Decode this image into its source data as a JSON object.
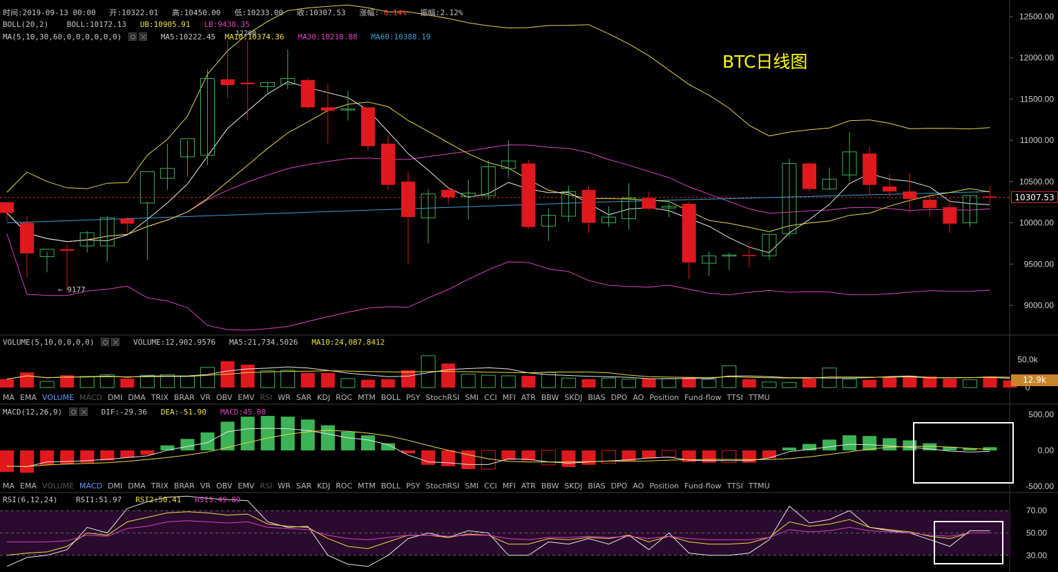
{
  "header": {
    "time_label": "时间:2019-09-13 00:00",
    "open_label": "开:10322.01",
    "high_label": "高:10450.00",
    "low_label": "低:10233.00",
    "close_label": "收:10307.53",
    "change_label": "涨幅:",
    "change_value": "-0.14%",
    "amplitude_label": "振幅:2.12%"
  },
  "boll": {
    "name": "BOLL(20,2)",
    "boll": "BOLL:10172.13",
    "ub": "UB:10905.91",
    "lb": "LB:9438.35"
  },
  "ma": {
    "name": "MA(5,10,30,60,0,0,0,0,0,0)",
    "ma5": "MA5:10222.45",
    "ma10": "MA10:10374.36",
    "ma30": "MA30:10218.88",
    "ma60": "MA60:10388.19"
  },
  "title": "BTC日线图",
  "price_tag": "10307.53",
  "volume_tag": "12.9k",
  "high_marker": "12200",
  "low_marker": "← 9177",
  "volume": {
    "name": "VOLUME(5,10,0,0,0,0)",
    "volume": "VOLUME:12,902.9576",
    "ma5": "MA5:21,734.5026",
    "ma10": "MA10:24,087.8412"
  },
  "macd": {
    "name": "MACD(12,26,9)",
    "dif": "DIF:-29.36",
    "dea": "DEA:-51.90",
    "macd": "MACD:45.08"
  },
  "rsi": {
    "name": "RSI(6,12,24)",
    "rsi1": "RSI1:51.97",
    "rsi2": "RSI2:50.41",
    "rsi3": "RSI3:49.89"
  },
  "indicator_tabs": [
    "MA",
    "EMA",
    "VOLUME",
    "MACD",
    "DMI",
    "DMA",
    "TRIX",
    "BRAR",
    "VR",
    "OBV",
    "EMV",
    "RSI",
    "WR",
    "SAR",
    "KDJ",
    "ROC",
    "MTM",
    "BOLL",
    "PSY",
    "StochRSI",
    "SMI",
    "CCI",
    "MFI",
    "ATR",
    "BBW",
    "SKDJ",
    "BIAS",
    "DPO",
    "AO",
    "Position",
    "Fund-flow",
    "TTSI",
    "TTMU"
  ],
  "colors": {
    "up": "#e0191e",
    "down": "#3cb357",
    "boll_up": "#e8d44d",
    "boll_mid": "#d8d8d8",
    "boll_low": "#e040c0",
    "ma5": "#e8e8e8",
    "ma10": "#f0dd40",
    "ma30": "#e040c0",
    "ma60": "#3aa0e0"
  },
  "chart_data": [
    {
      "type": "candlestick",
      "title": "BTC日线图",
      "ylim": [
        8800,
        12600
      ],
      "yticks": [
        9000,
        9500,
        10000,
        10500,
        11000,
        11500,
        12000,
        12500
      ],
      "ytick_labels": [
        "9000.00",
        "9500.00",
        "10000.00",
        "10500.00",
        "11000.00",
        "11500.00",
        "12000.00",
        "12500.00"
      ],
      "last_price": 10307.53,
      "candles": [
        [
          10250,
          10250,
          10020,
          10120
        ],
        [
          10000,
          10080,
          9340,
          9630
        ],
        [
          9590,
          9650,
          9400,
          9680
        ],
        [
          9680,
          9740,
          9177,
          9660
        ],
        [
          9720,
          9900,
          9640,
          9880
        ],
        [
          9720,
          10080,
          9530,
          10060
        ],
        [
          10050,
          10070,
          9880,
          9990
        ],
        [
          10240,
          10260,
          9550,
          10620
        ],
        [
          10540,
          10960,
          10400,
          10660
        ],
        [
          10800,
          11000,
          10560,
          11020
        ],
        [
          10820,
          11860,
          10700,
          11750
        ],
        [
          11740,
          12200,
          11510,
          11670
        ],
        [
          11700,
          12200,
          11240,
          11680
        ],
        [
          11650,
          11700,
          11560,
          11700
        ],
        [
          11680,
          12100,
          11620,
          11750
        ],
        [
          11730,
          11760,
          11380,
          11400
        ],
        [
          11400,
          11680,
          10960,
          11360
        ],
        [
          11380,
          11600,
          11240,
          11380
        ],
        [
          11400,
          11400,
          10880,
          10930
        ],
        [
          10960,
          11070,
          10400,
          10460
        ],
        [
          10500,
          10620,
          9500,
          10070
        ],
        [
          10060,
          10410,
          9750,
          10350
        ],
        [
          10400,
          10440,
          10220,
          10310
        ],
        [
          10320,
          10520,
          10040,
          10360
        ],
        [
          10330,
          10760,
          10280,
          10680
        ],
        [
          10660,
          11000,
          10550,
          10750
        ],
        [
          10720,
          10760,
          9930,
          9950
        ],
        [
          9960,
          10180,
          9780,
          10090
        ],
        [
          10080,
          10450,
          10010,
          10380
        ],
        [
          10400,
          10450,
          9880,
          10000
        ],
        [
          10000,
          10200,
          9950,
          10070
        ],
        [
          10050,
          10480,
          9920,
          10300
        ],
        [
          10300,
          10380,
          10150,
          10170
        ],
        [
          10180,
          10240,
          10070,
          10200
        ],
        [
          10230,
          10260,
          9320,
          9520
        ],
        [
          9510,
          9650,
          9360,
          9600
        ],
        [
          9600,
          9640,
          9430,
          9610
        ],
        [
          9610,
          9760,
          9460,
          9600
        ],
        [
          9600,
          9860,
          9550,
          9860
        ],
        [
          9870,
          10780,
          9830,
          10720
        ],
        [
          10720,
          10730,
          10380,
          10410
        ],
        [
          10410,
          10670,
          10400,
          10530
        ],
        [
          10580,
          11100,
          10510,
          10860
        ],
        [
          10840,
          10920,
          10330,
          10460
        ],
        [
          10440,
          10590,
          10320,
          10380
        ],
        [
          10380,
          10600,
          10120,
          10290
        ],
        [
          10280,
          10350,
          10070,
          10180
        ],
        [
          10190,
          10280,
          9880,
          9990
        ],
        [
          10000,
          10330,
          9950,
          10330
        ],
        [
          10320,
          10450,
          10233,
          10307.53
        ]
      ]
    },
    {
      "type": "bar",
      "title": "VOLUME(5,10,0,0,0,0)",
      "ytick_labels": [
        "50.0k",
        "0"
      ],
      "ylim": [
        0,
        68000
      ],
      "values": [
        15000,
        27000,
        11000,
        22000,
        20000,
        23000,
        16000,
        22000,
        23000,
        20000,
        36000,
        47000,
        41000,
        30000,
        31000,
        26000,
        26000,
        16000,
        14000,
        15000,
        31000,
        57000,
        43000,
        24000,
        22000,
        21000,
        21000,
        27000,
        17000,
        15000,
        17000,
        15000,
        16000,
        16000,
        18000,
        15000,
        39000,
        15000,
        10000,
        9000,
        16000,
        35000,
        15000,
        14000,
        18000,
        21000,
        20000,
        16000,
        14000,
        20000,
        12900
      ]
    },
    {
      "type": "bar",
      "title": "MACD(12,26,9)",
      "ytick_labels": [
        "500.00",
        "0.00",
        "-500.00"
      ],
      "ylim": [
        -500,
        500
      ],
      "values": [
        -300,
        -310,
        -200,
        -190,
        -170,
        -140,
        -100,
        -60,
        70,
        160,
        250,
        400,
        470,
        480,
        470,
        430,
        350,
        260,
        210,
        100,
        -40,
        -200,
        -220,
        -260,
        -260,
        -130,
        -140,
        -200,
        -230,
        -200,
        -180,
        -150,
        -110,
        -90,
        -160,
        -170,
        -170,
        -170,
        -110,
        40,
        90,
        150,
        210,
        200,
        170,
        140,
        100,
        50,
        30,
        45
      ]
    },
    {
      "type": "line",
      "title": "RSI(6,12,24)",
      "ytick_labels": [
        "70.00",
        "50.00",
        "30.00"
      ],
      "ylim": [
        15,
        85
      ],
      "series": [
        {
          "name": "RSI1",
          "values": [
            20,
            28,
            30,
            35,
            55,
            50,
            72,
            78,
            82,
            83,
            81,
            80,
            79,
            60,
            55,
            56,
            30,
            22,
            20,
            30,
            45,
            50,
            46,
            52,
            50,
            30,
            30,
            42,
            40,
            45,
            40,
            48,
            35,
            50,
            32,
            30,
            30,
            32,
            44,
            74,
            59,
            62,
            70,
            55,
            52,
            50,
            44,
            38,
            52,
            52
          ]
        },
        {
          "name": "RSI2",
          "values": [
            30,
            32,
            33,
            38,
            50,
            48,
            60,
            64,
            68,
            69,
            68,
            66,
            67,
            58,
            56,
            55,
            45,
            38,
            36,
            42,
            48,
            48,
            46,
            49,
            48,
            40,
            40,
            45,
            44,
            46,
            45,
            48,
            42,
            47,
            42,
            40,
            40,
            41,
            46,
            60,
            56,
            58,
            62,
            55,
            53,
            51,
            47,
            45,
            50,
            50
          ]
        },
        {
          "name": "RSI3",
          "values": [
            42,
            42,
            42,
            43,
            48,
            47,
            54,
            56,
            60,
            61,
            60,
            59,
            60,
            55,
            54,
            53,
            48,
            45,
            44,
            46,
            48,
            48,
            47,
            48,
            48,
            45,
            44,
            46,
            46,
            47,
            46,
            47,
            45,
            47,
            45,
            44,
            44,
            44,
            46,
            53,
            51,
            52,
            55,
            52,
            51,
            50,
            48,
            47,
            50,
            50
          ]
        }
      ],
      "reference_lines": [
        70,
        50,
        30
      ]
    }
  ]
}
